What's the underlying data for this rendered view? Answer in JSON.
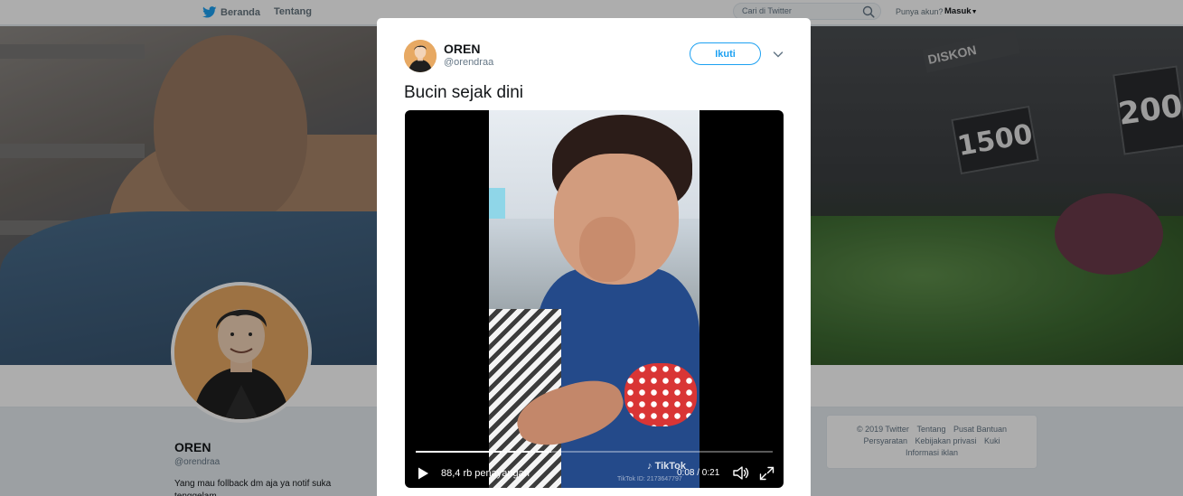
{
  "nav": {
    "home_label": "Beranda",
    "about_label": "Tentang",
    "search_placeholder": "Cari di Twitter",
    "account_prompt": "Punya akun?",
    "login_label": "Masuk"
  },
  "banner": {
    "diskon_text": "DISKON",
    "price_1": "1500",
    "price_2": "200"
  },
  "profile": {
    "name": "OREN",
    "handle": "@orendraa",
    "bio": "Yang mau follback dm aja ya notif suka tenggelam"
  },
  "footer": {
    "links": [
      "© 2019 Twitter",
      "Tentang",
      "Pusat Bantuan",
      "Persyaratan",
      "Kebijakan privasi",
      "Kuki",
      "Informasi iklan"
    ]
  },
  "tweet": {
    "author_name": "OREN",
    "author_handle": "@orendraa",
    "follow_label": "Ikuti",
    "text": "Bucin sejak dini"
  },
  "video": {
    "views": "88,4 rb penayangan",
    "time": "0:08 / 0:21",
    "progress": 0.38,
    "watermark": "TikTok",
    "watermark_id": "TikTok ID: 2173647797"
  },
  "colors": {
    "accent": "#1da1f2",
    "page_bg": "#e6ecf0",
    "overlay": "rgba(0,0,0,0.32)"
  },
  "icons": {
    "logo": "twitter-bird-icon",
    "search": "search-icon",
    "caret": "chevron-down-icon",
    "play": "play-icon",
    "volume": "volume-icon",
    "fullscreen": "fullscreen-icon"
  }
}
